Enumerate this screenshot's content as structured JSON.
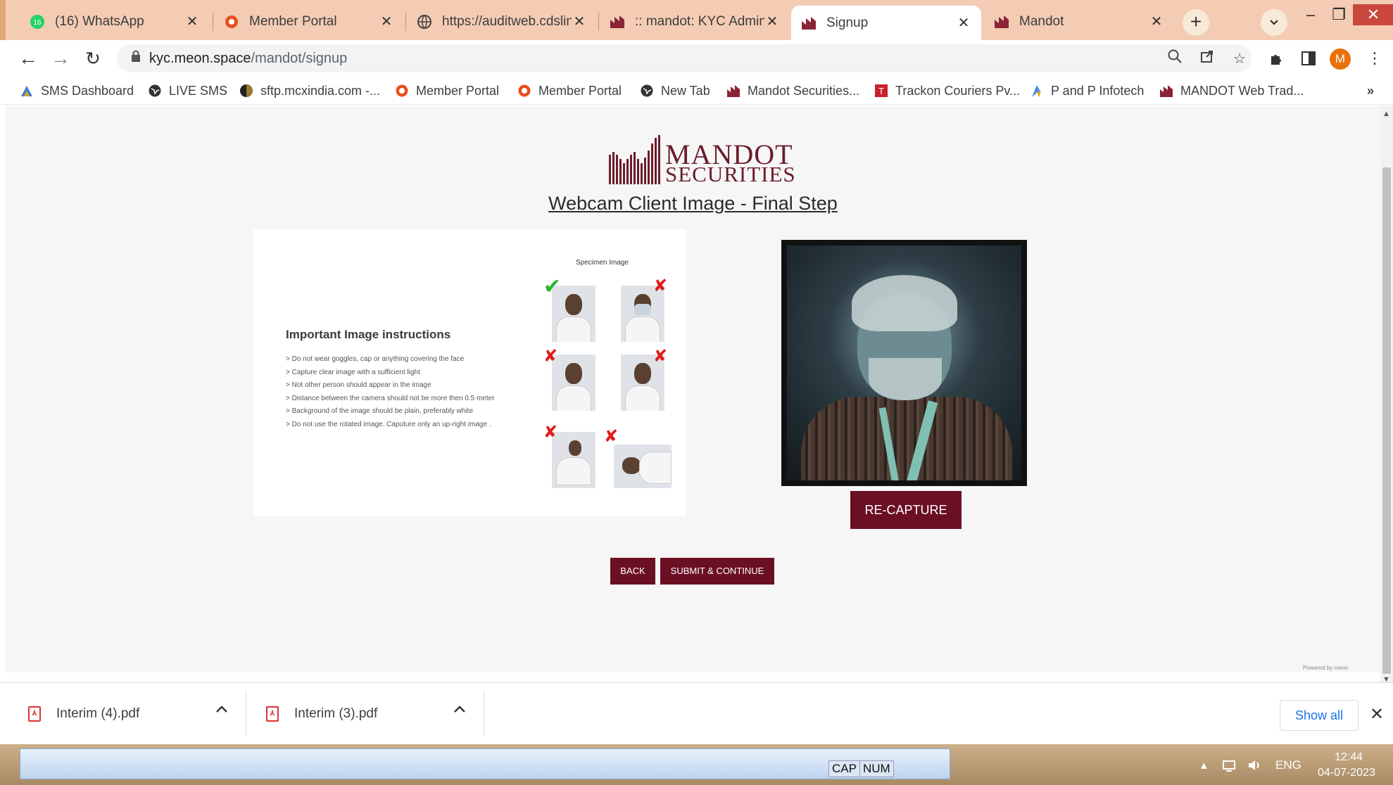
{
  "tabs": [
    {
      "title": "(16) WhatsApp",
      "icon": "whatsapp-icon",
      "active": false
    },
    {
      "title": "Member Portal",
      "icon": "portal-icon",
      "active": false
    },
    {
      "title": "https://auditweb.cdslin",
      "icon": "globe-icon",
      "active": false
    },
    {
      "title": ":: mandot: KYC Admin ::",
      "icon": "mandot-icon",
      "active": false
    },
    {
      "title": "Signup",
      "icon": "mandot-icon",
      "active": true
    },
    {
      "title": "Mandot",
      "icon": "mandot-icon",
      "active": false
    }
  ],
  "tab_close_glyph": "✕",
  "new_tab_glyph": "+",
  "address": {
    "host": "kyc.meon.space",
    "path": "/mandot/signup"
  },
  "bookmarks": [
    {
      "label": "SMS Dashboard",
      "icon": "sms-icon"
    },
    {
      "label": "LIVE SMS",
      "icon": "globe-icon"
    },
    {
      "label": "sftp.mcxindia.com -...",
      "icon": "mcx-icon"
    },
    {
      "label": "Member Portal",
      "icon": "portal-icon"
    },
    {
      "label": "Member Portal",
      "icon": "portal-icon"
    },
    {
      "label": "New Tab",
      "icon": "globe-icon"
    },
    {
      "label": "Mandot Securities...",
      "icon": "mandot-icon"
    },
    {
      "label": "Trackon Couriers Pv...",
      "icon": "trackon-icon"
    },
    {
      "label": "P and P Infotech",
      "icon": "infotech-icon"
    },
    {
      "label": "MANDOT Web Trad...",
      "icon": "mandot-icon"
    }
  ],
  "bookmarks_overflow": "»",
  "profile_initial": "M",
  "page": {
    "logo_line1": "MANDOT",
    "logo_line2": "SECURITIES",
    "heading": "Webcam Client Image - Final Step",
    "specimen_label": "Specimen Image",
    "instructions_title": "Important Image instructions",
    "instructions": [
      "> Do not wear goggles, cap or anything covering the face",
      "> Capture clear image with a sufficient light",
      "> Not other person  should appear in the image",
      "> Distance between the camera should not be more then  0.5 meter",
      "> Background of the image should be plain, preferably white",
      "> Do not use the rotated image. Caputure only an up-right image ."
    ],
    "recapture_label": "RE-CAPTURE",
    "back_label": "BACK",
    "submit_label": "SUBMIT & CONTINUE",
    "powered_by": "Powered by meon"
  },
  "downloads": [
    {
      "name": "Interim (4).pdf"
    },
    {
      "name": "Interim (3).pdf"
    }
  ],
  "show_all_label": "Show all",
  "taskbar": {
    "status_cap": "CAP",
    "status_num": "NUM",
    "language": "ENG",
    "time": "12:44",
    "date": "04-07-2023"
  },
  "colors": {
    "brand": "#6b0f24",
    "logo": "#6b1d2b",
    "tabstrip": "#f3ccb3",
    "link": "#1a73e8"
  }
}
